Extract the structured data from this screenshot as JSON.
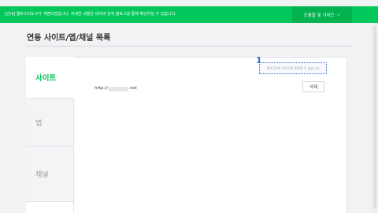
{
  "notice_bar": {
    "text": "[안내] 웹마스터도구가 개편되었습니다. 자세한 내용은 네이버 검색 블로그를 통해 확인하실 수 있습니다.",
    "help_button": "도움말 및 가이드",
    "help_icon": "chevron-down-icon",
    "color": "#03c75a"
  },
  "page": {
    "title": "연동 사이트/앱/채널 목록"
  },
  "tabs": [
    {
      "label": "사이트",
      "active": true
    },
    {
      "label": "앱",
      "active": false
    },
    {
      "label": "채널",
      "active": false
    }
  ],
  "annotation": {
    "step": "1",
    "hint": "최대 10개 사이트를 등록할 수 있습니다",
    "color": "#2b6fd6"
  },
  "sites": [
    {
      "url_prefix": "http://",
      "url_suffix": ".net",
      "delete_label": "삭제"
    }
  ]
}
